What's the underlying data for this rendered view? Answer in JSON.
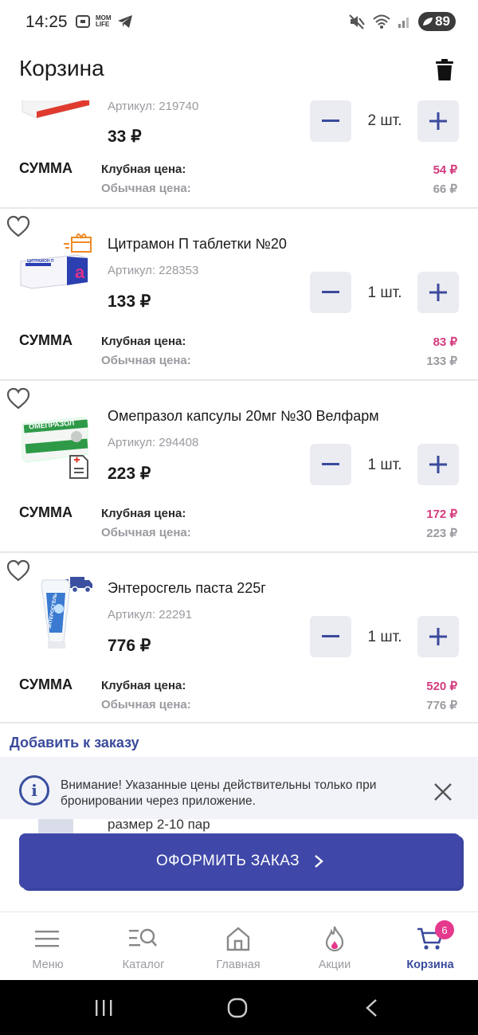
{
  "status_bar": {
    "time": "14:25",
    "operator_badge": "MOM\nLIFE",
    "battery": "89"
  },
  "header": {
    "title": "Корзина"
  },
  "items": [
    {
      "name": "",
      "article": "Артикул: 219740",
      "price": "33 ₽",
      "qty": "2 шт.",
      "sum_label": "СУММА",
      "club_label": "Клубная цена:",
      "club_price": "54 ₽",
      "regular_label": "Обычная цена:",
      "regular_price": "66 ₽"
    },
    {
      "name": "Цитрамон П таблетки №20",
      "article": "Артикул: 228353",
      "price": "133 ₽",
      "qty": "1 шт.",
      "sum_label": "СУММА",
      "club_label": "Клубная цена:",
      "club_price": "83 ₽",
      "regular_label": "Обычная цена:",
      "regular_price": "133 ₽",
      "badge_icon": "delivery-box-icon",
      "thumb_text": "ЦИТРАМОН П"
    },
    {
      "name": "Омепразол капсулы 20мг №30 Велфарм",
      "article": "Артикул: 294408",
      "price": "223 ₽",
      "qty": "1 шт.",
      "sum_label": "СУММА",
      "club_label": "Клубная цена:",
      "club_price": "172 ₽",
      "regular_label": "Обычная цена:",
      "regular_price": "223 ₽",
      "badge_icon": "prescription-icon",
      "thumb_text": "ОМЕПРАЗОЛ"
    },
    {
      "name": "Энтеросгель паста 225г",
      "article": "Артикул: 22291",
      "price": "776 ₽",
      "qty": "1 шт.",
      "sum_label": "СУММА",
      "club_label": "Клубная цена:",
      "club_price": "520 ₽",
      "regular_label": "Обычная цена:",
      "regular_price": "776 ₽",
      "badge_icon": "delivery-truck-icon",
      "thumb_text": "ЭНТЕРОСГЕЛЬ"
    }
  ],
  "add_to_order": "Добавить к заказу",
  "notice": {
    "text": "Внимание! Указанные цены действительны только при бронировании через приложение."
  },
  "peek_item_text": "размер 2-10 пар",
  "checkout": {
    "label": "ОФОРМИТЬ ЗАКАЗ"
  },
  "bottom_nav": [
    {
      "label": "Меню",
      "icon": "menu-icon"
    },
    {
      "label": "Каталог",
      "icon": "catalog-search-icon"
    },
    {
      "label": "Главная",
      "icon": "home-icon"
    },
    {
      "label": "Акции",
      "icon": "flame-icon"
    },
    {
      "label": "Корзина",
      "icon": "cart-icon",
      "badge": "6",
      "active": true
    }
  ],
  "colors": {
    "accent": "#3f48a8",
    "club_price": "#d43a7c",
    "badge": "#e5398d"
  }
}
